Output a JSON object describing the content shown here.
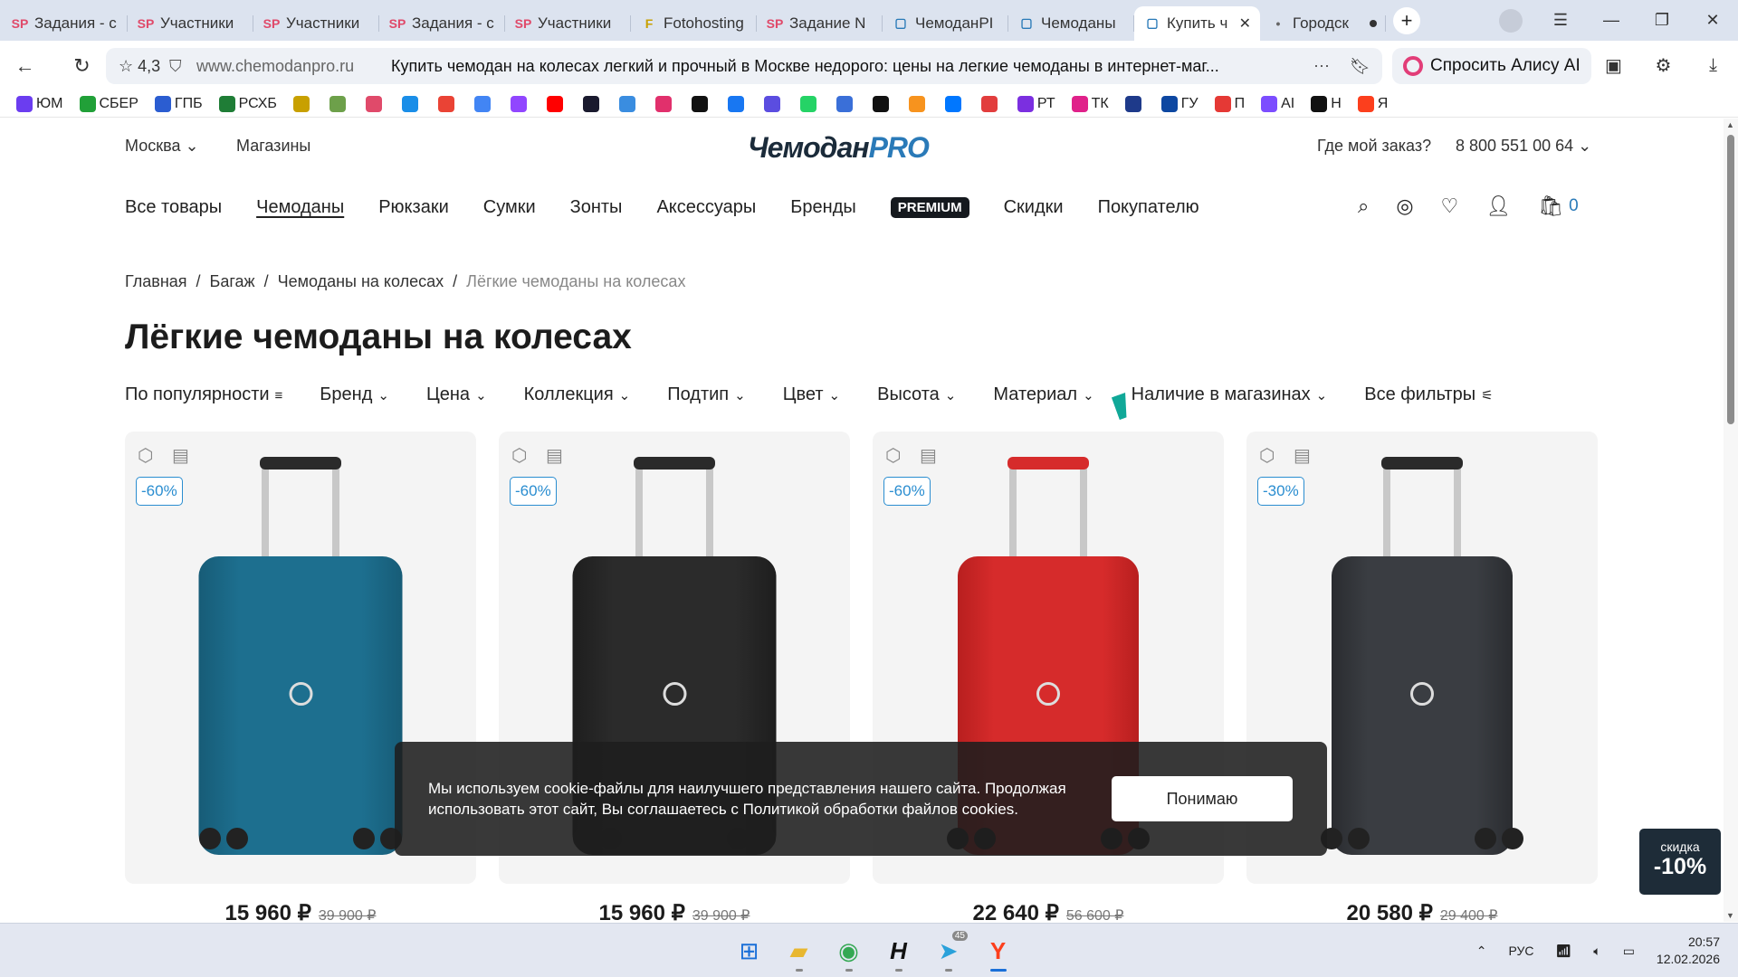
{
  "browser": {
    "tabs": [
      {
        "icon": "SP",
        "icon_color": "#e04a6a",
        "title": "Задания - с"
      },
      {
        "icon": "SP",
        "icon_color": "#e04a6a",
        "title": "Участники"
      },
      {
        "icon": "SP",
        "icon_color": "#e04a6a",
        "title": "Участники"
      },
      {
        "icon": "SP",
        "icon_color": "#e04a6a",
        "title": "Задания - с"
      },
      {
        "icon": "SP",
        "icon_color": "#e04a6a",
        "title": "Участники"
      },
      {
        "icon": "F",
        "icon_color": "#c8a000",
        "title": "Fotohosting"
      },
      {
        "icon": "SP",
        "icon_color": "#e04a6a",
        "title": "Задание N"
      },
      {
        "icon": "suitcase",
        "icon_color": "#2a7ab8",
        "title": "ЧемоданPI"
      },
      {
        "icon": "suitcase",
        "icon_color": "#2a7ab8",
        "title": "Чемоданы"
      },
      {
        "icon": "suitcase",
        "icon_color": "#2a7ab8",
        "title": "Купить ч"
      },
      {
        "icon": "dot",
        "icon_color": "#666666",
        "title": "Городск"
      }
    ],
    "active_tab": 9,
    "address": {
      "rating": "4,3",
      "url": "www.chemodanpro.ru",
      "page_title": "Купить чемодан на колесах легкий и прочный в Москве недорого: цены на легкие чемоданы в интернет-маг..."
    },
    "alice_label": "Спросить Алису AI",
    "bookmarks": [
      {
        "label": "ЮМ",
        "color": "#6b3df0"
      },
      {
        "label": "СБЕР",
        "color": "#21a038"
      },
      {
        "label": "ГПБ",
        "color": "#2b5dd1"
      },
      {
        "label": "РСХБ",
        "color": "#1f7d36"
      },
      {
        "label": "",
        "color": "#c8a000"
      },
      {
        "label": "",
        "color": "#6da04a"
      },
      {
        "label": "",
        "color": "#e04a6a"
      },
      {
        "label": "",
        "color": "#1a8ee8"
      },
      {
        "label": "",
        "color": "#ea4335"
      },
      {
        "label": "",
        "color": "#4285f4"
      },
      {
        "label": "",
        "color": "#9146ff"
      },
      {
        "label": "",
        "color": "#ff0000"
      },
      {
        "label": "",
        "color": "#1a1a2e"
      },
      {
        "label": "",
        "color": "#3a8de0"
      },
      {
        "label": "",
        "color": "#e1306c"
      },
      {
        "label": "",
        "color": "#111111"
      },
      {
        "label": "",
        "color": "#1877f2"
      },
      {
        "label": "",
        "color": "#5b4de0"
      },
      {
        "label": "",
        "color": "#25d366"
      },
      {
        "label": "",
        "color": "#3a6fd8"
      },
      {
        "label": "",
        "color": "#111111"
      },
      {
        "label": "",
        "color": "#f7931e"
      },
      {
        "label": "",
        "color": "#0077ff"
      },
      {
        "label": "",
        "color": "#e23d3d"
      },
      {
        "label": "РТ",
        "color": "#7b2fe0"
      },
      {
        "label": "ТК",
        "color": "#e0218a"
      },
      {
        "label": "",
        "color": "#1e3a8a"
      },
      {
        "label": "ГУ",
        "color": "#0d47a1"
      },
      {
        "label": "П",
        "color": "#e53935"
      },
      {
        "label": "AI",
        "color": "#7c4dff"
      },
      {
        "label": "Н",
        "color": "#111111"
      },
      {
        "label": "Я",
        "color": "#fc3f1d"
      }
    ]
  },
  "site": {
    "city": "Москва",
    "shops": "Магазины",
    "logo_main": "Чемодан",
    "logo_pro": "PRO",
    "order_link": "Где мой заказ?",
    "phone": "8 800 551 00 64",
    "nav": [
      "Все товары",
      "Чемоданы",
      "Рюкзаки",
      "Сумки",
      "Зонты",
      "Аксессуары",
      "Бренды",
      "PREMIUM",
      "Скидки",
      "Покупателю"
    ],
    "cart_count": "0",
    "breadcrumbs": [
      "Главная",
      "Багаж",
      "Чемоданы на колесах",
      "Лёгкие чемоданы на колесах"
    ],
    "page_heading": "Лёгкие чемоданы на колесах",
    "filters": [
      "По популярности",
      "Бренд",
      "Цена",
      "Коллекция",
      "Подтип",
      "Цвет",
      "Высота",
      "Материал",
      "Наличие в магазинах",
      "Все фильтры"
    ],
    "products": [
      {
        "badge": "-60%",
        "price": "15 960 ₽",
        "old_price": "39 900 ₽",
        "color": "#1d6f8f",
        "shade": "#175c77",
        "type": "soft"
      },
      {
        "badge": "-60%",
        "price": "15 960 ₽",
        "old_price": "39 900 ₽",
        "color": "#2b2b2b",
        "shade": "#1e1e1e",
        "type": "soft"
      },
      {
        "badge": "-60%",
        "price": "22 640 ₽",
        "old_price": "56 600 ₽",
        "color": "#d62b2b",
        "shade": "#b81f1f",
        "type": "hard"
      },
      {
        "badge": "-30%",
        "price": "20 580 ₽",
        "old_price": "29 400 ₽",
        "color": "#3a3d42",
        "shade": "#2a2c30",
        "type": "hard"
      }
    ],
    "cookie": {
      "text": "Мы используем cookie-файлы для наилучшего представления нашего сайта. Продолжая использовать этот сайт, Вы соглашаетесь с Политикой обработки файлов cookies.",
      "button": "Понимаю"
    },
    "promo": {
      "label": "скидка",
      "value": "-10%"
    }
  },
  "taskbar": {
    "lang": "РУС",
    "time": "20:57",
    "date": "12.02.2026",
    "telegram_badge": "45"
  }
}
